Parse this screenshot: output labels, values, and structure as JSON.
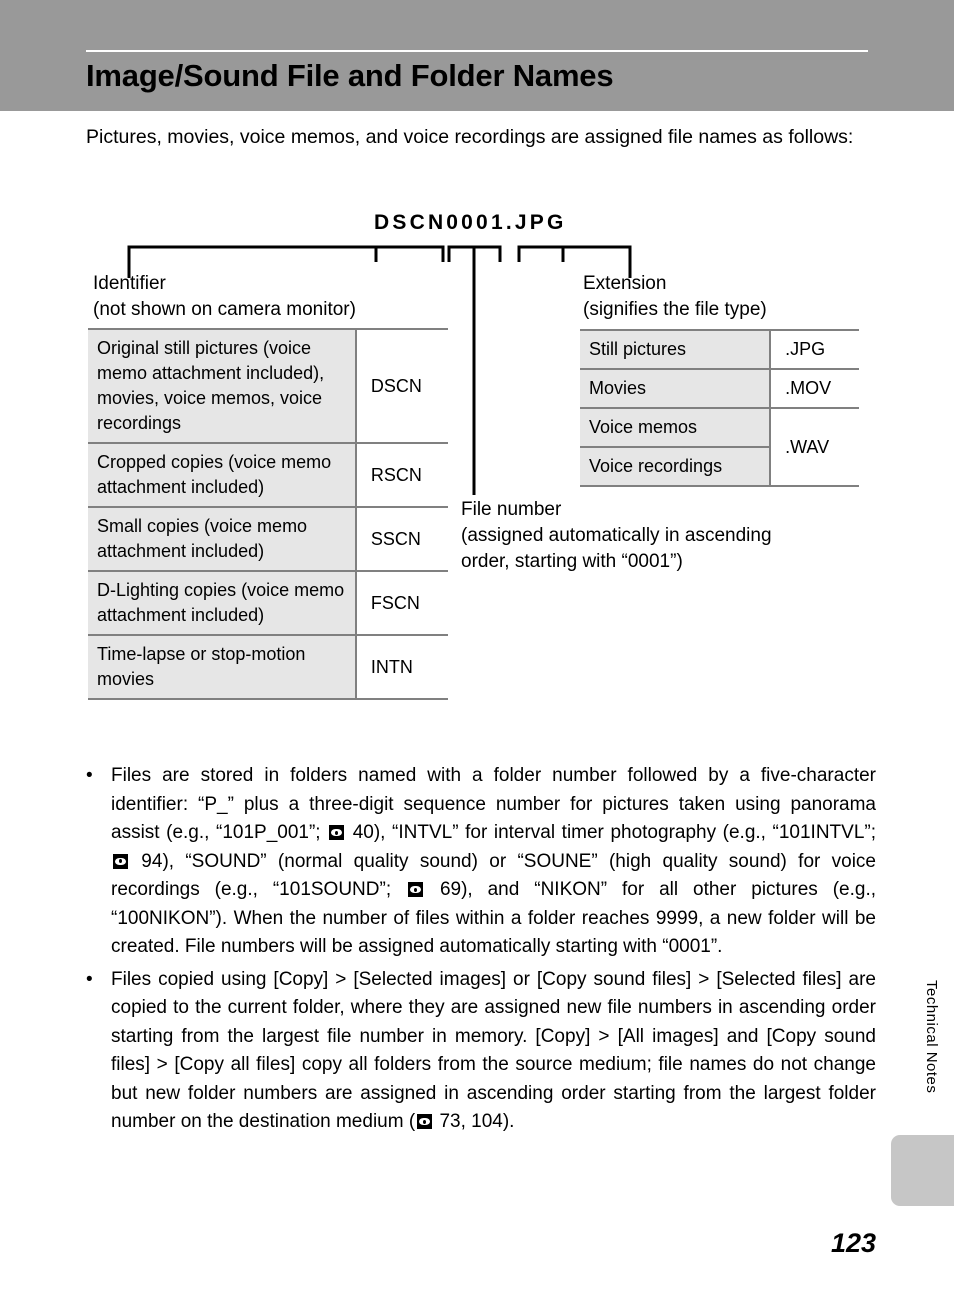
{
  "header": {
    "title": "Image/Sound File and Folder Names"
  },
  "intro": "Pictures, movies, voice memos, and voice recordings are assigned file names as follows:",
  "diagram": {
    "filename_sample": "DSCN0001.JPG",
    "identifier_label_line1": "Identifier",
    "identifier_label_line2": "(not shown on camera monitor)",
    "extension_label_line1": "Extension",
    "extension_label_line2": "(signifies the file type)",
    "filenumber_label_line1": "File number",
    "filenumber_label_line2": "(assigned automatically in ascending",
    "filenumber_label_line3": "order, starting with “0001”)"
  },
  "identifier_table": {
    "rows": [
      {
        "desc": "Original still pictures (voice memo attachment included), movies, voice memos, voice recordings",
        "code": "DSCN"
      },
      {
        "desc": "Cropped copies (voice memo attachment included)",
        "code": "RSCN"
      },
      {
        "desc": "Small copies (voice memo attachment included)",
        "code": "SSCN"
      },
      {
        "desc": "D-Lighting copies (voice memo attachment included)",
        "code": "FSCN"
      },
      {
        "desc": "Time-lapse or stop-motion movies",
        "code": "INTN"
      }
    ]
  },
  "extension_table": {
    "rows": [
      {
        "desc": "Still pictures",
        "code": ".JPG"
      },
      {
        "desc": "Movies",
        "code": ".MOV"
      },
      {
        "desc": "Voice memos",
        "code": ".WAV"
      },
      {
        "desc": "Voice recordings",
        "code": ""
      }
    ]
  },
  "bullets": [
    {
      "mark": "•",
      "segments": [
        {
          "type": "text",
          "value": "Files are stored in folders named with a folder number followed by a five-character identifier: “P_” plus a three-digit sequence number for pictures taken using panorama assist (e.g., “101P_001”; "
        },
        {
          "type": "icon",
          "value": "xref-icon"
        },
        {
          "type": "text",
          "value": " 40), “INTVL” for interval timer photography (e.g., “101INTVL”; "
        },
        {
          "type": "icon",
          "value": "xref-icon"
        },
        {
          "type": "text",
          "value": " 94), “SOUND” (normal quality sound) or “SOUNE” (high quality sound) for voice recordings (e.g., “101SOUND”; "
        },
        {
          "type": "icon",
          "value": "xref-icon"
        },
        {
          "type": "text",
          "value": " 69), and “NIKON” for all other pictures (e.g., “100NIKON”). When the number of files within a folder reaches 9999, a new folder will be created. File numbers will be assigned automatically starting with “0001”."
        }
      ]
    },
    {
      "mark": "•",
      "segments": [
        {
          "type": "text",
          "value": "Files copied using [Copy] > [Selected images] or [Copy sound files] > [Selected files] are copied to the current folder, where they are assigned new file numbers in ascending order starting from the largest file number in memory. [Copy] > [All images] and [Copy sound files] > [Copy all files] copy all folders from the source medium; file names do not change but new folder numbers are assigned in ascending order starting from the largest folder number on the destination medium ("
        },
        {
          "type": "icon",
          "value": "xref-icon"
        },
        {
          "type": "text",
          "value": " 73, 104)."
        }
      ]
    }
  ],
  "side_tab": {
    "label": "Technical Notes"
  },
  "page_number": "123",
  "colors": {
    "header_band": "#999999",
    "table_border": "#808080",
    "table_desc_fill": "#e6e6e6",
    "side_tab_fill": "#c6c6c6"
  }
}
